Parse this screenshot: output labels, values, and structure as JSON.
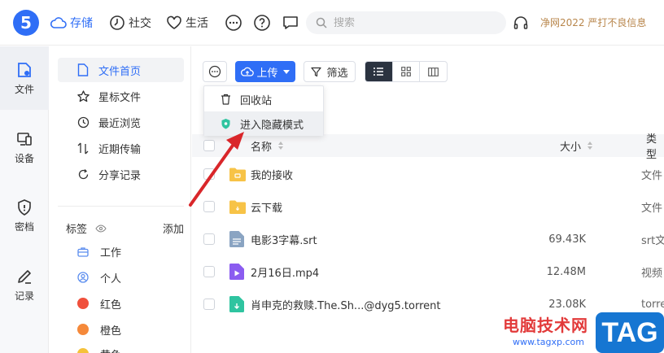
{
  "app": {
    "logo_text": "5"
  },
  "nav": {
    "items": [
      {
        "label": "存储",
        "icon": "cloud-icon"
      },
      {
        "label": "社交",
        "icon": "clock-icon"
      },
      {
        "label": "生活",
        "icon": "heart-icon"
      }
    ],
    "more_icon": "more-icon",
    "help_icon": "help-icon",
    "chat_icon": "chat-icon"
  },
  "search": {
    "placeholder": "搜索"
  },
  "notice": {
    "text": "净网2022 严打不良信息"
  },
  "rail": {
    "items": [
      {
        "label": "文件",
        "icon": "file-icon",
        "active": true
      },
      {
        "label": "设备",
        "icon": "device-icon"
      },
      {
        "label": "密档",
        "icon": "shield-icon"
      },
      {
        "label": "记录",
        "icon": "pen-icon"
      }
    ]
  },
  "sidebar": {
    "items": [
      {
        "label": "文件首页",
        "icon": "document-icon",
        "active": true
      },
      {
        "label": "星标文件",
        "icon": "star-icon"
      },
      {
        "label": "最近浏览",
        "icon": "history-icon"
      },
      {
        "label": "近期传输",
        "icon": "transfer-icon"
      },
      {
        "label": "分享记录",
        "icon": "share-icon"
      }
    ],
    "tags_label": "标签",
    "add_label": "添加",
    "tags": [
      {
        "label": "工作",
        "color": "#5b8def",
        "kind": "briefcase-icon"
      },
      {
        "label": "个人",
        "color": "#5b8def",
        "kind": "person-icon"
      },
      {
        "label": "红色",
        "color": "#f0503c"
      },
      {
        "label": "橙色",
        "color": "#f5893a"
      },
      {
        "label": "黄色",
        "color": "#f5c23a"
      }
    ]
  },
  "toolbar": {
    "upload_label": "上传",
    "filter_label": "筛选"
  },
  "dropdown": {
    "items": [
      {
        "label": "回收站",
        "icon": "trash-icon"
      },
      {
        "label": "进入隐藏模式",
        "icon": "hidden-mode-icon"
      }
    ]
  },
  "table": {
    "col_name": "名称",
    "col_size": "大小",
    "col_type": "类型",
    "rows": [
      {
        "name": "我的接收",
        "size": "",
        "type": "文件",
        "icon": "folder-icon"
      },
      {
        "name": "云下载",
        "size": "",
        "type": "文件",
        "icon": "folder-icon"
      },
      {
        "name": "电影3字幕.srt",
        "size": "69.43K",
        "type": "srt文",
        "icon": "text-file-icon"
      },
      {
        "name": "2月16日.mp4",
        "size": "12.48M",
        "type": "视频",
        "icon": "video-file-icon"
      },
      {
        "name": "肖申克的救赎.The.Sh...@dyg5.torrent",
        "size": "23.08K",
        "type": "torrent",
        "icon": "torrent-file-icon"
      }
    ]
  },
  "watermark": {
    "text": "电脑技术网",
    "url": "www.tagxp.com",
    "tag": "TAG"
  },
  "colors": {
    "accent": "#2f6ef6",
    "folder": "#f7c347",
    "arrow": "#d9262a"
  }
}
